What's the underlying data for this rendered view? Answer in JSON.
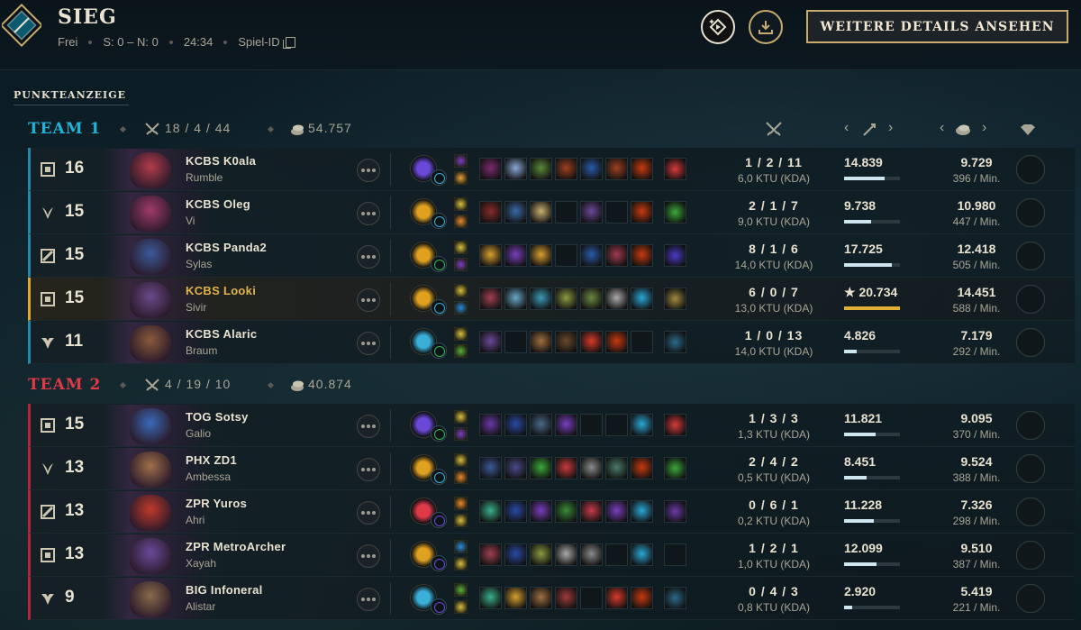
{
  "header": {
    "result": "SIEG",
    "queue": "Frei",
    "score": "S: 0 – N: 0",
    "duration": "24:34",
    "game_id_label": "Spiel-ID",
    "details_button": "WEITERE DETAILS ANSEHEN"
  },
  "scoreboard": {
    "label": "PUNKTEANZEIGE",
    "teams": [
      {
        "name": "TEAM 1",
        "color": "#1fb4d6",
        "kda": "18 / 4 / 44",
        "gold": "54.757",
        "players": [
          {
            "level": "16",
            "name": "KCBS K0ala",
            "champion": "Rumble",
            "kda": "1 / 2 / 11",
            "ktu": "6,0 KTU (KDA)",
            "damage": "14.839",
            "damage_fill": 0.72,
            "gold": "9.729",
            "gpm": "396 / Min.",
            "role": "top",
            "face": "#b23b4a",
            "rune": "#6b48d8",
            "sub": "#3ab0d8",
            "spells": [
              "#7a3fbf",
              "#e8a03a"
            ],
            "items": [
              "#7c2a6e",
              "#8aa8d8",
              "#5a8a3a",
              "#a04020",
              "#2a5aa8",
              "#a04020",
              "#c83a10"
            ],
            "trinket": "#d83a3a"
          },
          {
            "level": "15",
            "name": "KCBS Oleg",
            "champion": "Vi",
            "kda": "2 / 1 / 7",
            "ktu": "9,0 KTU (KDA)",
            "damage": "9.738",
            "damage_fill": 0.48,
            "gold": "10.980",
            "gpm": "447 / Min.",
            "role": "jungle",
            "face": "#a03a6a",
            "rune": "#e0a020",
            "sub": "#3ab0d8",
            "spells": [
              "#d8c040",
              "#e88a30"
            ],
            "items": [
              "#8a2a2a",
              "#3a6aa8",
              "#c8b070",
              "",
              "#6a4a9a",
              "",
              "#c83a10"
            ],
            "trinket": "#3aa83a"
          },
          {
            "level": "15",
            "name": "KCBS Panda2",
            "champion": "Sylas",
            "kda": "8 / 1 / 6",
            "ktu": "14,0 KTU (KDA)",
            "damage": "17.725",
            "damage_fill": 0.86,
            "gold": "12.418",
            "gpm": "505 / Min.",
            "role": "mid",
            "face": "#3a5a9a",
            "rune": "#e0a020",
            "sub": "#3ab05a",
            "spells": [
              "#d8c040",
              "#7a3fbf"
            ],
            "items": [
              "#d8a030",
              "#7a3fbf",
              "#d8a030",
              "",
              "#2a5aa8",
              "#a03a50",
              "#c83a10"
            ],
            "trinket": "#4a3ac8"
          },
          {
            "level": "15",
            "name": "KCBS Looki",
            "champion": "Sivir",
            "kda": "6 / 0 / 7",
            "ktu": "13,0 KTU (KDA)",
            "damage": "★ 20.734",
            "damage_fill": 1.0,
            "gold": "14.451",
            "gpm": "588 / Min.",
            "role": "bottom",
            "face": "#6a4a8a",
            "rune": "#e0a020",
            "sub": "#3ab0d8",
            "spells": [
              "#d8c040",
              "#2a8ad8"
            ],
            "items": [
              "#a04050",
              "#6aa8c8",
              "#3a9ab8",
              "#8a9a40",
              "#6a8a40",
              "#aaaaaa",
              "#2aa8d8"
            ],
            "trinket": "#a08a40"
          },
          {
            "level": "11",
            "name": "KCBS Alaric",
            "champion": "Braum",
            "kda": "1 / 0 / 13",
            "ktu": "14,0 KTU (KDA)",
            "damage": "4.826",
            "damage_fill": 0.22,
            "gold": "7.179",
            "gpm": "292 / Min.",
            "role": "support",
            "face": "#8a5a3a",
            "rune": "#3ab0d8",
            "sub": "#3ab05a",
            "spells": [
              "#d8c040",
              "#5ab03a"
            ],
            "items": [
              "#6a4a9a",
              "",
              "#a07040",
              "#6a4a2a",
              "#d83a2a",
              "#c83a10",
              ""
            ],
            "trinket": "#2a6a8a"
          }
        ]
      },
      {
        "name": "TEAM 2",
        "color": "#e03a48",
        "kda": "4 / 19 / 10",
        "gold": "40.874",
        "players": [
          {
            "level": "15",
            "name": "TOG Sotsy",
            "champion": "Galio",
            "kda": "1 / 3 / 3",
            "ktu": "1,3 KTU (KDA)",
            "damage": "11.821",
            "damage_fill": 0.57,
            "gold": "9.095",
            "gpm": "370 / Min.",
            "role": "top",
            "face": "#3a6ab8",
            "rune": "#6b48d8",
            "sub": "#3ab05a",
            "spells": [
              "#d8c040",
              "#7a3fbf"
            ],
            "items": [
              "#6a3aa8",
              "#2a4aa8",
              "#4a6a8a",
              "#7a3fbf",
              "",
              "",
              "#2aa8d8"
            ],
            "trinket": "#d83a3a"
          },
          {
            "level": "13",
            "name": "PHX ZD1",
            "champion": "Ambessa",
            "kda": "2 / 4 / 2",
            "ktu": "0,5 KTU (KDA)",
            "damage": "8.451",
            "damage_fill": 0.41,
            "gold": "9.524",
            "gpm": "388 / Min.",
            "role": "jungle",
            "face": "#a0704a",
            "rune": "#e0a020",
            "sub": "#3ab0d8",
            "spells": [
              "#d8c040",
              "#e88a30"
            ],
            "items": [
              "#3a5a9a",
              "#4a4a8a",
              "#3aa83a",
              "#c83a3a",
              "#8a8a8a",
              "#4a7a6a",
              "#c83a10"
            ],
            "trinket": "#3aa83a"
          },
          {
            "level": "13",
            "name": "ZPR Yuros",
            "champion": "Ahri",
            "kda": "0 / 6 / 1",
            "ktu": "0,2 KTU (KDA)",
            "damage": "11.228",
            "damage_fill": 0.54,
            "gold": "7.326",
            "gpm": "298 / Min.",
            "role": "mid",
            "face": "#c03a2a",
            "rune": "#e03a48",
            "sub": "#6b48d8",
            "spells": [
              "#e88a30",
              "#d8c040"
            ],
            "items": [
              "#3ab08a",
              "#2a4aa8",
              "#7a3fbf",
              "#3a8a3a",
              "#c83a4a",
              "#7a3fbf",
              "#2aa8d8"
            ],
            "trinket": "#6a3aa8"
          },
          {
            "level": "13",
            "name": "ZPR MetroArcher",
            "champion": "Xayah",
            "kda": "1 / 2 / 1",
            "ktu": "1,0 KTU (KDA)",
            "damage": "12.099",
            "damage_fill": 0.58,
            "gold": "9.510",
            "gpm": "387 / Min.",
            "role": "bottom",
            "face": "#6a4a9a",
            "rune": "#e0a020",
            "sub": "#6b48d8",
            "spells": [
              "#2a8ad8",
              "#d8c040"
            ],
            "items": [
              "#a04050",
              "#2a4aa8",
              "#8a9a40",
              "#aaaaaa",
              "#8a8a8a",
              "",
              "#2aa8d8"
            ],
            "trinket": ""
          },
          {
            "level": "9",
            "name": "BIG Infoneral",
            "champion": "Alistar",
            "kda": "0 / 4 / 3",
            "ktu": "0,8 KTU (KDA)",
            "damage": "2.920",
            "damage_fill": 0.14,
            "gold": "5.419",
            "gpm": "221 / Min.",
            "role": "support",
            "face": "#8a6a4a",
            "rune": "#3ab0d8",
            "sub": "#6b48d8",
            "spells": [
              "#5ab03a",
              "#d8c040"
            ],
            "items": [
              "#3ab08a",
              "#d8a030",
              "#a07040",
              "#a03a3a",
              "",
              "#d83a2a",
              "#c83a10"
            ],
            "trinket": "#2a6a8a"
          }
        ]
      }
    ]
  }
}
